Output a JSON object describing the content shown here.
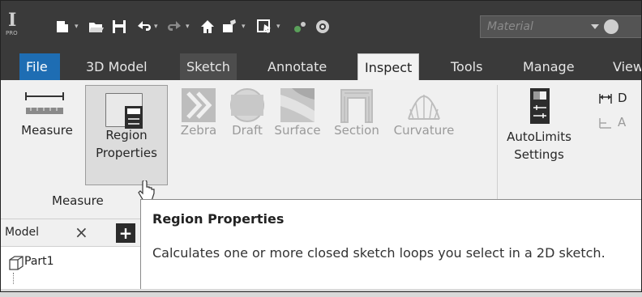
{
  "app": {
    "pro_label": "PRO"
  },
  "qat": {
    "material_label": "Material"
  },
  "tabs": [
    {
      "label": "File"
    },
    {
      "label": "3D Model"
    },
    {
      "label": "Sketch"
    },
    {
      "label": "Annotate"
    },
    {
      "label": "Inspect"
    },
    {
      "label": "Tools"
    },
    {
      "label": "Manage"
    },
    {
      "label": "View"
    }
  ],
  "ribbon": {
    "measure": {
      "label": "Measure"
    },
    "region_properties": {
      "line1": "Region",
      "line2": "Properties"
    },
    "zebra": {
      "label": "Zebra"
    },
    "draft": {
      "label": "Draft"
    },
    "surface": {
      "label": "Surface"
    },
    "section": {
      "label": "Section"
    },
    "curvature": {
      "label": "Curvature"
    },
    "autolimits": {
      "line1": "AutoLimits",
      "line2": "Settings"
    },
    "side_letter_1": "D",
    "side_letter_2": "A",
    "panel_measure": "Measure"
  },
  "browser": {
    "tab_label": "Model",
    "close_glyph": "×",
    "add_glyph": "+",
    "part_label": "Part1"
  },
  "tooltip": {
    "title": "Region Properties",
    "description": "Calculates one or more closed sketch loops you select in a 2D sketch."
  },
  "colors": {
    "file_tab": "#1e6db3",
    "dark_bar": "#3a3a3a",
    "ribbon_bg": "#f0f0f0"
  }
}
